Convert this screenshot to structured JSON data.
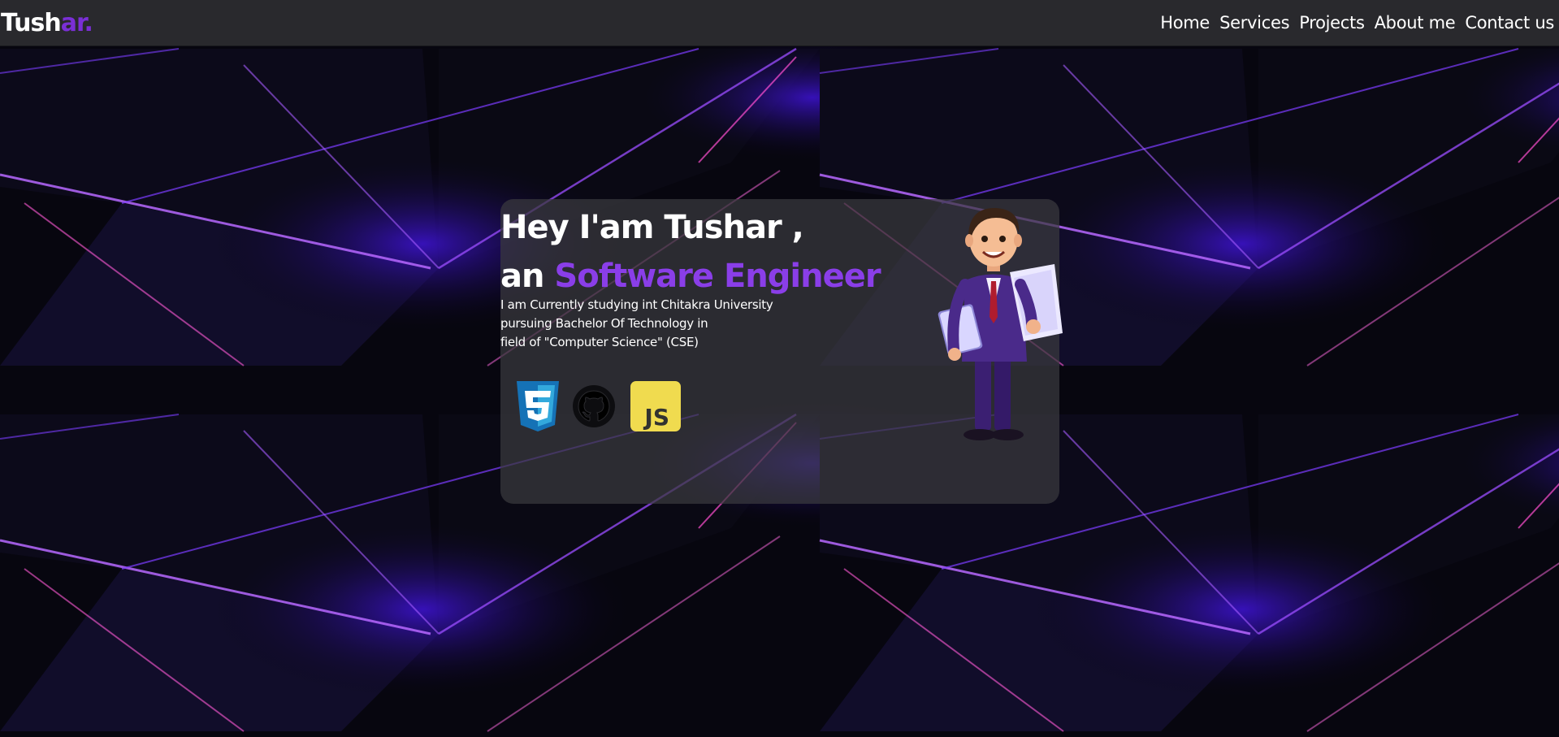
{
  "brand": {
    "logo_start": "Tush",
    "logo_accent": "ar."
  },
  "nav": {
    "items": [
      "Home",
      "Services",
      "Projects",
      "About me",
      "Contact us"
    ]
  },
  "hero": {
    "line1": "Hey I'am Tushar ,",
    "line2_prefix": "an ",
    "line2_highlight": "Software Engineer",
    "description": [
      "I am Currently studying int Chitakra University",
      "pursuing Bachelor Of Technology in",
      "field of \"Computer Science\" (CSE)"
    ]
  },
  "skills": {
    "icons": [
      "css3-icon",
      "github-icon",
      "javascript-icon"
    ],
    "js_text": "JS"
  },
  "colors": {
    "accent": "#8a3ee8",
    "background": "#07060f",
    "card": "#3a3a3e",
    "css_blue": "#1f6ec4",
    "js_yellow": "#f0db4f"
  }
}
